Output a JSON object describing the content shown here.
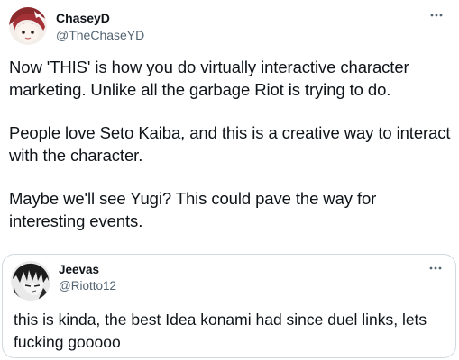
{
  "tweet": {
    "author_name": "ChaseyD",
    "author_handle": "@TheChaseYD",
    "avatar_icon": "anime-girl-avatar-icon",
    "more_icon": "more-options-icon",
    "paragraphs": [
      "Now 'THIS' is how you do virtually interactive character marketing. Unlike all the garbage Riot is trying to do.",
      "People love Seto Kaiba, and this is a creative way to interact with the character.",
      "Maybe we'll see Yugi? This could pave the way for interesting events."
    ]
  },
  "quote": {
    "author_name": "Jeevas",
    "author_handle": "@Riotto12",
    "avatar_icon": "manga-character-avatar-icon",
    "more_icon": "more-options-icon",
    "text": "this is kinda, the best Idea konami had since duel links, lets fucking gooooo"
  }
}
